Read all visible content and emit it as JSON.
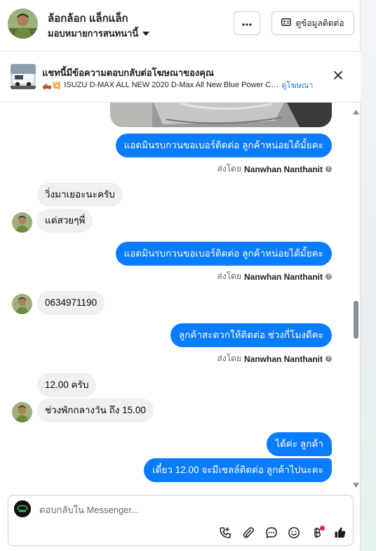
{
  "header": {
    "contact_name": "ล้อกล้อก แล็กแล็ก",
    "assignment_label": "มอบหมายการสนทนานี้",
    "more_button": "···",
    "contact_info_button": "ดูข้อมูลติดต่อ"
  },
  "ad_banner": {
    "title": "แชทนี้มีข้อความตอบกลับต่อโฆษณาของคุณ",
    "emojis": "🛻💥",
    "description": "ISUZU D-MAX ALL NEW 2020 D-Max All New Blue Power Cab-...",
    "link": "ดูโฆษณา"
  },
  "messages": [
    {
      "direction": "out",
      "text": "แอดมินรบกวนขอเบอร์ติดต่อ ลูกค้าหน่อยได้มั้ยคะ"
    },
    {
      "direction": "meta",
      "prefix": "ส่งโดย",
      "name": "Nanwhan Nanthanit"
    },
    {
      "direction": "in",
      "text": "วิ่งมาเยอะนะครับ"
    },
    {
      "direction": "in",
      "text": "แต่สวยๆพี่"
    },
    {
      "direction": "out",
      "text": "แอดมินรบกวนขอเบอร์ติดต่อ ลูกค้าหน่อยได้มั้ยคะ"
    },
    {
      "direction": "meta",
      "prefix": "ส่งโดย",
      "name": "Nanwhan Nanthanit"
    },
    {
      "direction": "in",
      "text": "0634971190"
    },
    {
      "direction": "out",
      "text": "ลูกค้าสะดวกให้ติดต่อ ช่วงกี่โมงดีคะ"
    },
    {
      "direction": "meta",
      "prefix": "ส่งโดย",
      "name": "Nanwhan Nanthanit"
    },
    {
      "direction": "in",
      "text": "12.00 ครับ"
    },
    {
      "direction": "in",
      "text": "ช่วงพักกลางวัน ถึง 15.00"
    },
    {
      "direction": "out",
      "text": "ได้ค่ะ  ลูกค้า"
    },
    {
      "direction": "out",
      "text": "เดี๋ยว 12.00 จะมีเซลล์ติดต่อ ลูกค้าไปนะคะ"
    }
  ],
  "composer": {
    "placeholder": "ตอบกลับใน Messenger...",
    "tools": [
      "call-icon",
      "attach-icon",
      "saved-reply-icon",
      "emoji-icon",
      "payment-icon",
      "like-icon"
    ]
  },
  "colors": {
    "outgoing_bubble": "#0a7cff",
    "incoming_bubble": "#f0f0f0",
    "link": "#1877f2",
    "notification_dot": "#e41e3f"
  }
}
